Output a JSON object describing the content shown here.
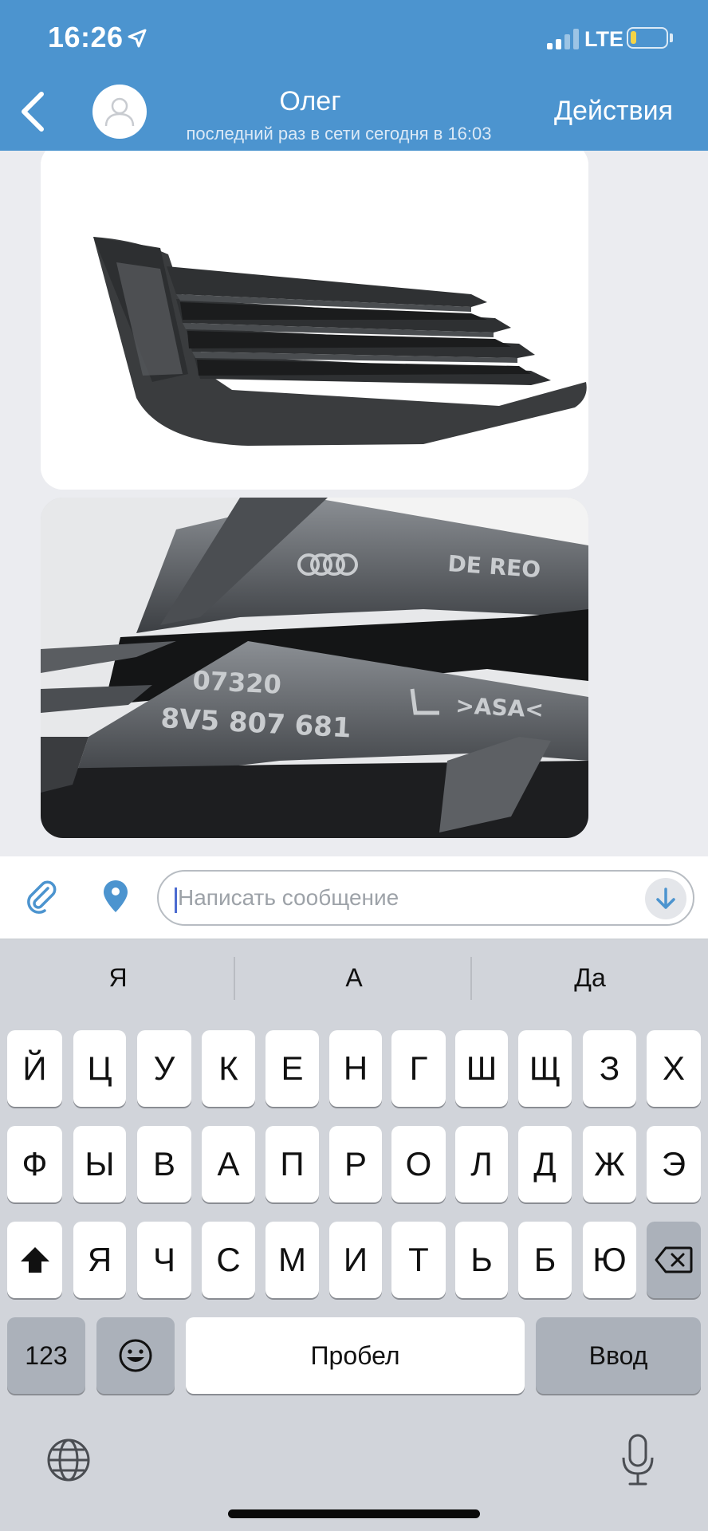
{
  "status_bar": {
    "time": "16:26",
    "network": "LTE",
    "battery_level": 0.15,
    "battery_color": "#f4d448"
  },
  "header": {
    "contact_name": "Олег",
    "contact_status": "последний раз в сети сегодня в 16:03",
    "actions_label": "Действия",
    "back_icon": "chevron-left-icon",
    "avatar_icon": "person-icon",
    "bg_color": "#4c94cf"
  },
  "messages": [
    {
      "type": "photo",
      "subject": "grille-photo"
    },
    {
      "type": "photo",
      "subject": "part-marking-closeup",
      "visible_markings": {
        "logo": "audi-rings",
        "brand_text": "DE REO",
        "code_top": "07320",
        "part_number": "8V5 807 681",
        "material": ">ASA<"
      }
    }
  ],
  "input": {
    "placeholder": "Написать сообщение",
    "value": "",
    "attach_icon": "paperclip-icon",
    "location_icon": "location-pin-icon",
    "scroll_icon": "arrow-down-icon"
  },
  "keyboard": {
    "suggestions": [
      "Я",
      "А",
      "Да"
    ],
    "row1": [
      "Й",
      "Ц",
      "У",
      "К",
      "Е",
      "Н",
      "Г",
      "Ш",
      "Щ",
      "З",
      "Х"
    ],
    "row2": [
      "Ф",
      "Ы",
      "В",
      "А",
      "П",
      "Р",
      "О",
      "Л",
      "Д",
      "Ж",
      "Э"
    ],
    "row3": [
      "Я",
      "Ч",
      "С",
      "М",
      "И",
      "Т",
      "Ь",
      "Б",
      "Ю"
    ],
    "numbers_label": "123",
    "space_label": "Пробел",
    "return_label": "Ввод"
  }
}
